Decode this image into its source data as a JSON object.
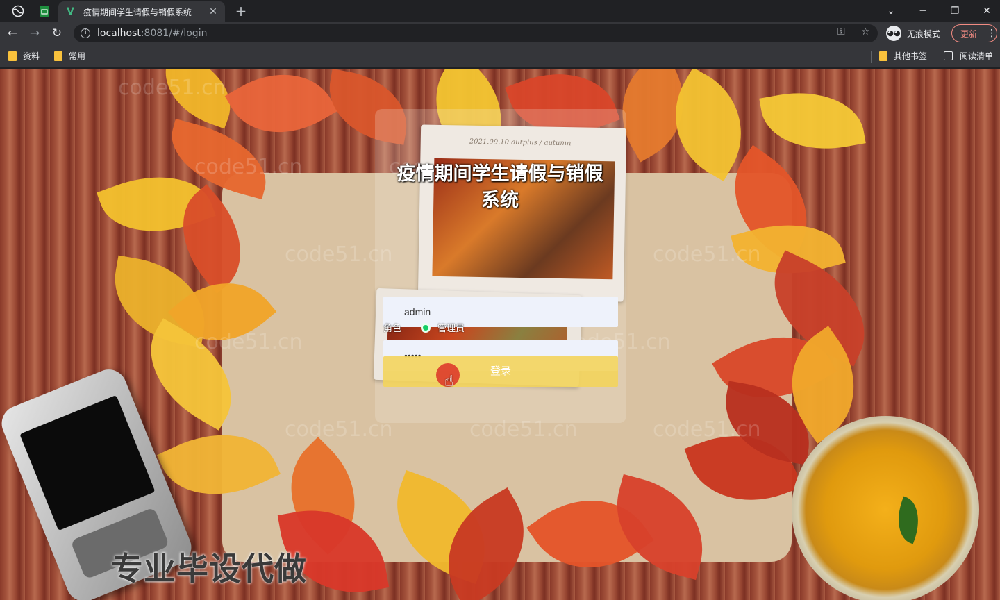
{
  "browser": {
    "tab_title": "疫情期间学生请假与销假系统",
    "url_host": "localhost",
    "url_rest": ":8081/#/login",
    "incognito_label": "无痕模式",
    "update_label": "更新",
    "bookmarks_left": [
      {
        "label": "资料"
      },
      {
        "label": "常用"
      }
    ],
    "bookmarks_right": [
      {
        "label": "其他书签",
        "icon": "folder-icon"
      },
      {
        "label": "阅读清单",
        "icon": "reading-list-icon"
      }
    ]
  },
  "login": {
    "title": "疫情期间学生请假与销假系统",
    "username_value": "admin",
    "password_value": "•••••",
    "role_label": "角色",
    "role_option": "管理员",
    "submit_label": "登录"
  },
  "decor": {
    "card_caption": "2021.09.10  autplus / autumn",
    "promo_text": "专业毕设代做",
    "watermark": "code51.cn"
  },
  "colors": {
    "accent_button": "#f3d45c",
    "radio_checked": "#13ce66",
    "input_bg": "#eef2fb"
  }
}
